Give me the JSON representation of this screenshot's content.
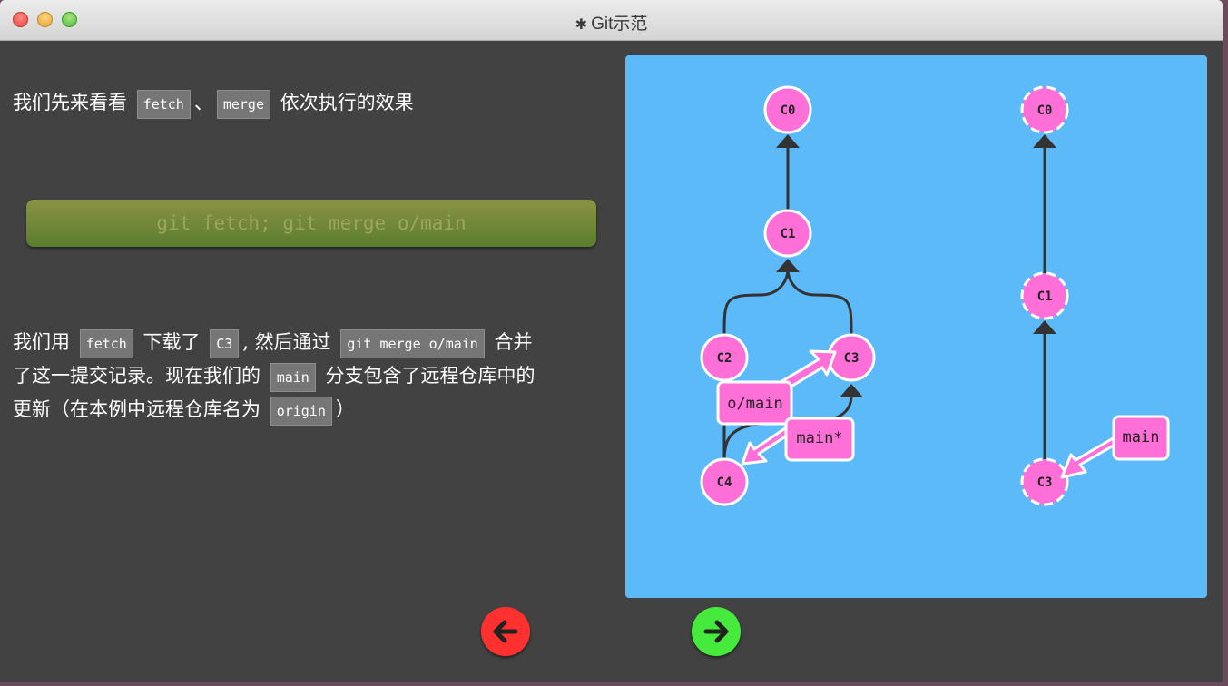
{
  "window": {
    "title": "Git示范"
  },
  "intro": {
    "before": "我们先来看看",
    "cmd1": "fetch",
    "sep": "、",
    "cmd2": "merge",
    "after": "依次执行的效果"
  },
  "command": {
    "text": "git fetch; git merge o/main"
  },
  "explanation": {
    "p1": "我们用",
    "c1": "fetch",
    "p2": "下载了",
    "c2": "C3",
    "p3": ", 然后通过",
    "c3": "git merge o/main",
    "p4": "合并",
    "p5": "了这一提交记录。现在我们的",
    "c4": "main",
    "p6": "分支包含了远程仓库中的",
    "p7": "更新（在本例中远程仓库名为",
    "c5": "origin",
    "p8": "）"
  },
  "graph": {
    "local": {
      "commits": [
        "C0",
        "C1",
        "C2",
        "C3",
        "C4"
      ],
      "branches": {
        "remote": "o/main",
        "current": "main*"
      }
    },
    "remote": {
      "commits": [
        "C0",
        "C1",
        "C3"
      ],
      "branches": {
        "main": "main"
      }
    }
  },
  "navigation": {
    "back": "back-arrow",
    "forward": "forward-arrow"
  },
  "colors": {
    "canvas": "#5cbaf8",
    "commit": "#ff6fd8",
    "back": "#ff3030",
    "forward": "#46ea3c"
  }
}
